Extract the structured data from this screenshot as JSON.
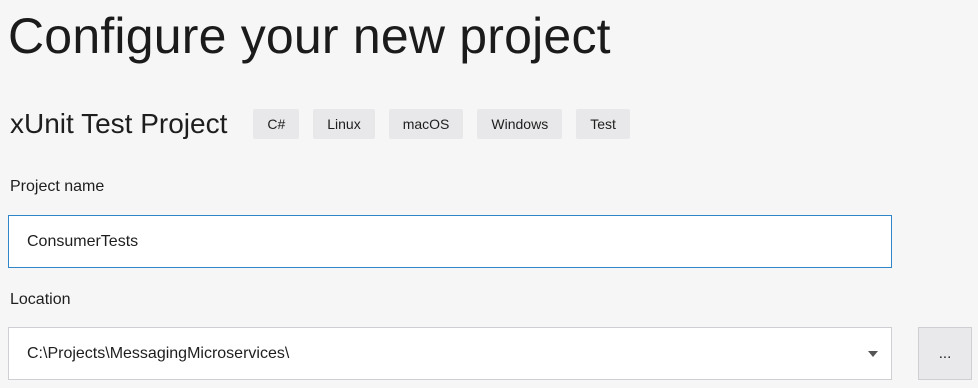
{
  "page": {
    "title": "Configure your new project"
  },
  "template": {
    "name": "xUnit Test Project",
    "tags": [
      "C#",
      "Linux",
      "macOS",
      "Windows",
      "Test"
    ]
  },
  "project_name": {
    "label": "Project name",
    "value": "ConsumerTests"
  },
  "location": {
    "label": "Location",
    "value": "C:\\Projects\\MessagingMicroservices\\",
    "browse_label": "..."
  },
  "colors": {
    "background": "#f6f6f7",
    "focus_border": "#2f86c9",
    "tag_background": "#e8e8ea"
  },
  "icons": {
    "dropdown": "chevron-down-icon"
  }
}
